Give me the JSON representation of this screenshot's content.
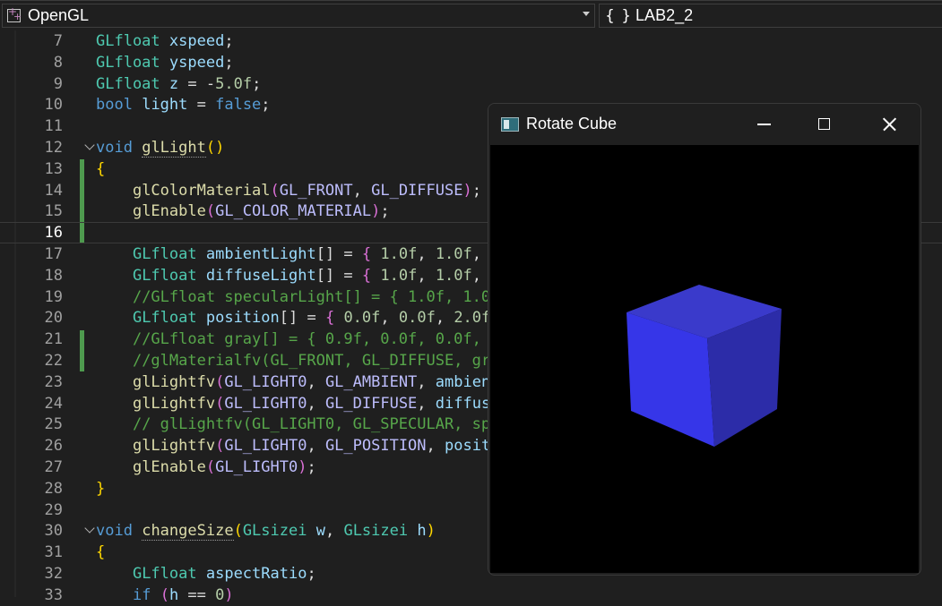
{
  "navbar": {
    "project": "OpenGL",
    "scope": "LAB2_2"
  },
  "editor": {
    "current_line": 16,
    "lines": [
      {
        "n": "7",
        "html": "<span class='ty'>GLfloat</span> <span class='va'>xspeed</span>;"
      },
      {
        "n": "8",
        "html": "<span class='ty'>GLfloat</span> <span class='va'>yspeed</span>;"
      },
      {
        "n": "9",
        "html": "<span class='ty'>GLfloat</span> <span class='va'>z</span> = -<span class='nu'>5.0f</span>;"
      },
      {
        "n": "10",
        "html": "<span class='kw'>bool</span> <span class='va'>light</span> = <span class='kw'>false</span>;"
      },
      {
        "n": "11",
        "html": ""
      },
      {
        "n": "12",
        "html": "<span class='kw'>void</span> <span class='fn dotted'>glLight</span><span class='b1'>()</span>"
      },
      {
        "n": "13",
        "html": "<span class='b1'>{</span>"
      },
      {
        "n": "14",
        "html": "    <span class='fn'>glColorMaterial</span><span class='b2'>(</span><span class='mc'>GL_FRONT</span>, <span class='mc'>GL_DIFFUSE</span><span class='b2'>)</span>;"
      },
      {
        "n": "15",
        "html": "    <span class='fn'>glEnable</span><span class='b2'>(</span><span class='mc'>GL_COLOR_MATERIAL</span><span class='b2'>)</span>;"
      },
      {
        "n": "16",
        "html": ""
      },
      {
        "n": "17",
        "html": "    <span class='ty'>GLfloat</span> <span class='va'>ambientLight</span>[] = <span class='b2'>{</span> <span class='nu'>1.0f</span>, <span class='nu'>1.0f</span>,"
      },
      {
        "n": "18",
        "html": "    <span class='ty'>GLfloat</span> <span class='va'>diffuseLight</span>[] = <span class='b2'>{</span> <span class='nu'>1.0f</span>, <span class='nu'>1.0f</span>,"
      },
      {
        "n": "19",
        "html": "    <span class='cm'>//GLfloat specularLight[] = { 1.0f, 1.0</span>"
      },
      {
        "n": "20",
        "html": "    <span class='ty'>GLfloat</span> <span class='va'>position</span>[] = <span class='b2'>{</span> <span class='nu'>0.0f</span>, <span class='nu'>0.0f</span>, <span class='nu'>2.0f</span>"
      },
      {
        "n": "21",
        "html": "    <span class='cm'>//GLfloat gray[] = { 0.9f, 0.0f, 0.0f,</span>"
      },
      {
        "n": "22",
        "html": "    <span class='cm'>//glMaterialfv(GL_FRONT, GL_DIFFUSE, gr</span>"
      },
      {
        "n": "23",
        "html": "    <span class='fn'>glLightfv</span><span class='b2'>(</span><span class='mc'>GL_LIGHT0</span>, <span class='mc'>GL_AMBIENT</span>, <span class='va'>ambien</span>"
      },
      {
        "n": "24",
        "html": "    <span class='fn'>glLightfv</span><span class='b2'>(</span><span class='mc'>GL_LIGHT0</span>, <span class='mc'>GL_DIFFUSE</span>, <span class='va'>diffus</span>"
      },
      {
        "n": "25",
        "html": "    <span class='cm'>// glLightfv(GL_LIGHT0, GL_SPECULAR, sp</span>"
      },
      {
        "n": "26",
        "html": "    <span class='fn'>glLightfv</span><span class='b2'>(</span><span class='mc'>GL_LIGHT0</span>, <span class='mc'>GL_POSITION</span>, <span class='va'>posit</span>"
      },
      {
        "n": "27",
        "html": "    <span class='fn'>glEnable</span><span class='b2'>(</span><span class='mc'>GL_LIGHT0</span><span class='b2'>)</span>;"
      },
      {
        "n": "28",
        "html": "<span class='b1'>}</span>"
      },
      {
        "n": "29",
        "html": ""
      },
      {
        "n": "30",
        "html": "<span class='kw'>void</span> <span class='fn dotted'>changeSize</span><span class='b1'>(</span><span class='ty'>GLsizei</span> <span class='va'>w</span>, <span class='ty'>GLsizei</span> <span class='va'>h</span><span class='b1'>)</span>"
      },
      {
        "n": "31",
        "html": "<span class='b1'>{</span>"
      },
      {
        "n": "32",
        "html": "    <span class='ty'>GLfloat</span> <span class='va'>aspectRatio</span>;"
      },
      {
        "n": "33",
        "html": "    <span class='kw'>if</span> <span class='b2'>(</span><span class='va'>h</span> == <span class='nu'>0</span><span class='b2'>)</span>"
      }
    ]
  },
  "window": {
    "title": "Rotate Cube",
    "cube_color": "#3a3ad0"
  }
}
